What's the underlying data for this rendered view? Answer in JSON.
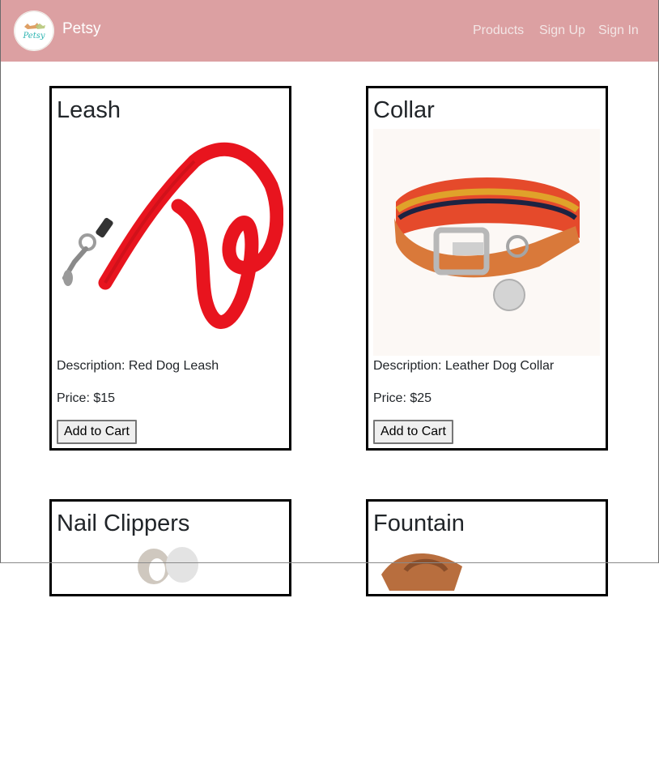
{
  "navbar": {
    "brand": "Petsy",
    "logo_text": "Petsy",
    "links": [
      "Products",
      "Sign Up",
      "Sign In"
    ]
  },
  "products": [
    {
      "name": "Leash",
      "description": "Description: Red Dog Leash",
      "price": "Price: $15",
      "button": "Add to Cart"
    },
    {
      "name": "Collar",
      "description": "Description: Leather Dog Collar",
      "price": "Price: $25",
      "button": "Add to Cart"
    },
    {
      "name": "Nail Clippers"
    },
    {
      "name": "Fountain"
    }
  ],
  "colors": {
    "navbar": "#dca0a2",
    "leash": "#e8141e",
    "collar_leather": "#d9793a"
  }
}
